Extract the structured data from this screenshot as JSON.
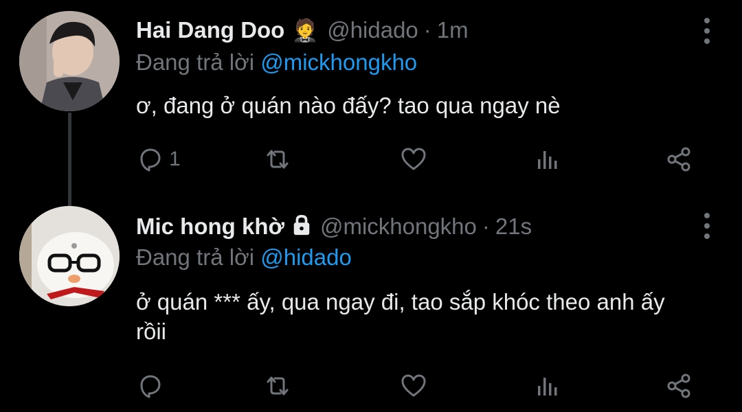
{
  "tweets": [
    {
      "name": "Hai Dang Doo",
      "badge": "🤵",
      "handle": "@hidado",
      "separator": "·",
      "time": "1m",
      "reply_prefix": "Đang trả lời ",
      "reply_mention": "@mickhongkho",
      "text": "ơ, đang ở quán nào đấy? tao qua ngay nè",
      "reply_count": "1",
      "icons": [
        "reply-icon",
        "retweet-icon",
        "like-icon",
        "views-icon",
        "share-icon",
        "more-icon"
      ]
    },
    {
      "name": "Mic hong khờ",
      "badge": "lock-icon",
      "handle": "@mickhongkho",
      "separator": "·",
      "time": "21s",
      "reply_prefix": "Đang trả lời ",
      "reply_mention": "@hidado",
      "text": "ở quán *** ấy, qua ngay đi, tao sắp khóc theo anh ấy rồii",
      "reply_count": "",
      "icons": [
        "reply-icon",
        "retweet-icon",
        "like-icon",
        "views-icon",
        "share-icon",
        "more-icon"
      ]
    }
  ],
  "colors": {
    "background": "#000000",
    "text_primary": "#e7e9ea",
    "text_secondary": "#71767b",
    "mention": "#1d9bf0",
    "thread_line": "#333639"
  }
}
